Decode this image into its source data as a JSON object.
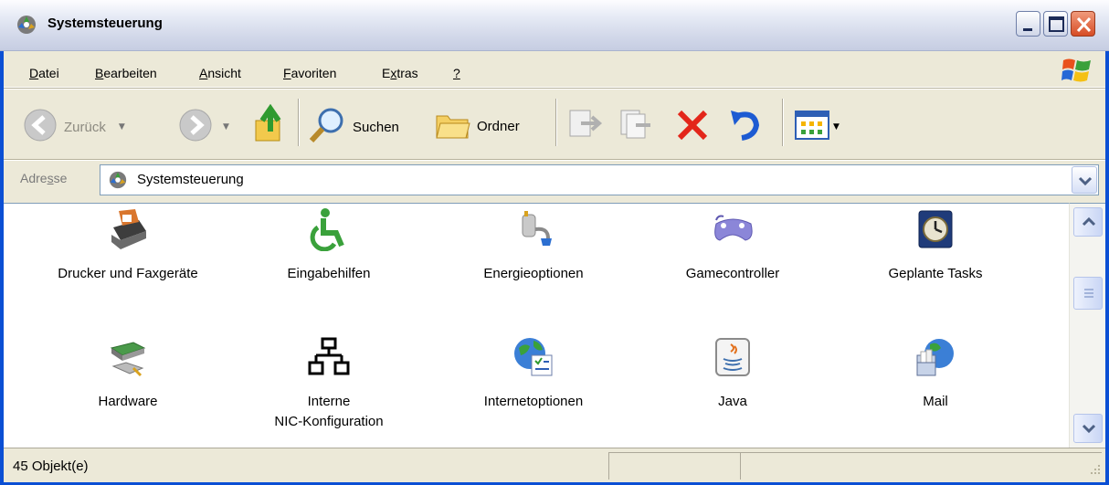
{
  "window": {
    "title": "Systemsteuerung"
  },
  "menu": [
    {
      "label": "Datei",
      "key": "D",
      "rest": "atei"
    },
    {
      "label": "Bearbeiten",
      "key": "B",
      "rest": "earbeiten"
    },
    {
      "label": "Ansicht",
      "key": "A",
      "rest": "nsicht"
    },
    {
      "label": "Favoriten",
      "key": "F",
      "rest": "avoriten"
    },
    {
      "label": "Extras",
      "pre": "E",
      "key": "x",
      "rest": "tras"
    },
    {
      "label": "?",
      "key": "?",
      "rest": ""
    }
  ],
  "toolbar": {
    "back_label": "Zurück",
    "search_label": "Suchen",
    "folders_label": "Ordner"
  },
  "address": {
    "label_pre": "Adre",
    "label_key": "s",
    "label_post": "se",
    "value": "Systemsteuerung"
  },
  "items": [
    {
      "label": "Drucker und Faxgeräte",
      "icon": "printer-fax-icon"
    },
    {
      "label": "Eingabehilfen",
      "icon": "accessibility-icon"
    },
    {
      "label": "Energieoptionen",
      "icon": "power-plug-icon"
    },
    {
      "label": "Gamecontroller",
      "icon": "gamepad-icon"
    },
    {
      "label": "Geplante Tasks",
      "icon": "clock-icon"
    },
    {
      "label": "Hardware",
      "icon": "hardware-icon"
    },
    {
      "label": "Interne\nNIC-Konfiguration",
      "icon": "network-icon"
    },
    {
      "label": "Internetoptionen",
      "icon": "globe-icon"
    },
    {
      "label": "Java",
      "icon": "java-icon"
    },
    {
      "label": "Mail",
      "icon": "mail-icon"
    }
  ],
  "status": {
    "text": "45 Objekt(e)"
  },
  "colors": {
    "frame": "#0b4fd4",
    "face": "#ece9d8",
    "close": "#d74c25",
    "delete": "#e3261a"
  }
}
